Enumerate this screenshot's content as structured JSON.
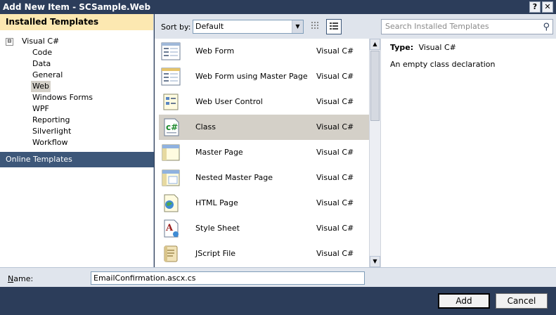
{
  "window": {
    "title": "Add New Item - SCSample.Web",
    "help_label": "?",
    "close_label": "✕"
  },
  "left": {
    "header": "Installed Templates",
    "root": {
      "expander": "⊟",
      "label": "Visual C#"
    },
    "items": [
      "Code",
      "Data",
      "General",
      "Web",
      "Windows Forms",
      "WPF",
      "Reporting",
      "Silverlight",
      "Workflow"
    ],
    "selected_item": "Web",
    "online": "Online Templates"
  },
  "toolbar": {
    "sort_label": "Sort by:",
    "sort_value": "Default",
    "search_placeholder": "Search Installed Templates"
  },
  "templates": [
    {
      "name": "Web Form",
      "lang": "Visual C#",
      "icon": "web-form-icon"
    },
    {
      "name": "Web Form using Master Page",
      "lang": "Visual C#",
      "icon": "web-form-master-icon"
    },
    {
      "name": "Web User Control",
      "lang": "Visual C#",
      "icon": "user-control-icon"
    },
    {
      "name": "Class",
      "lang": "Visual C#",
      "icon": "csharp-class-icon",
      "selected": true
    },
    {
      "name": "Master Page",
      "lang": "Visual C#",
      "icon": "master-page-icon"
    },
    {
      "name": "Nested Master Page",
      "lang": "Visual C#",
      "icon": "nested-master-page-icon"
    },
    {
      "name": "HTML Page",
      "lang": "Visual C#",
      "icon": "html-page-icon"
    },
    {
      "name": "Style Sheet",
      "lang": "Visual C#",
      "icon": "style-sheet-icon"
    },
    {
      "name": "JScript File",
      "lang": "Visual C#",
      "icon": "jscript-file-icon"
    }
  ],
  "details": {
    "type_label": "Type:",
    "type_value": "Visual C#",
    "description": "An empty class declaration"
  },
  "name_field": {
    "label": "Name:",
    "value": "EmailConfirmation.ascx.cs"
  },
  "buttons": {
    "add": "Add",
    "cancel": "Cancel"
  }
}
